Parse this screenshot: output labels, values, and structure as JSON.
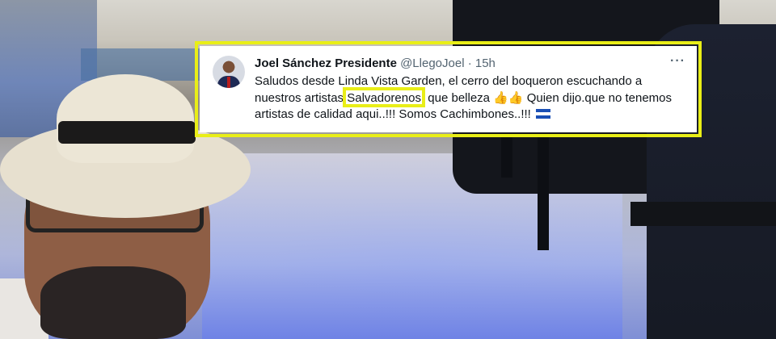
{
  "tweet": {
    "author_name": "Joel Sánchez Presidente",
    "handle": "@LlegoJoel",
    "separator": "·",
    "time": "15h",
    "more_label": "···",
    "text_part1": "Saludos desde Linda Vista Garden, el cerro del boqueron escuchando a nuestros artistas ",
    "highlighted_word": "Salvadorenos",
    "text_part2": ", que belleza ",
    "emoji": "👍👍",
    "text_part3": " Quien dijo.que no tenemos artistas de calidad aqui..!!! Somos Cachimbones..!!!",
    "highlight_color": "#e9ee17"
  }
}
